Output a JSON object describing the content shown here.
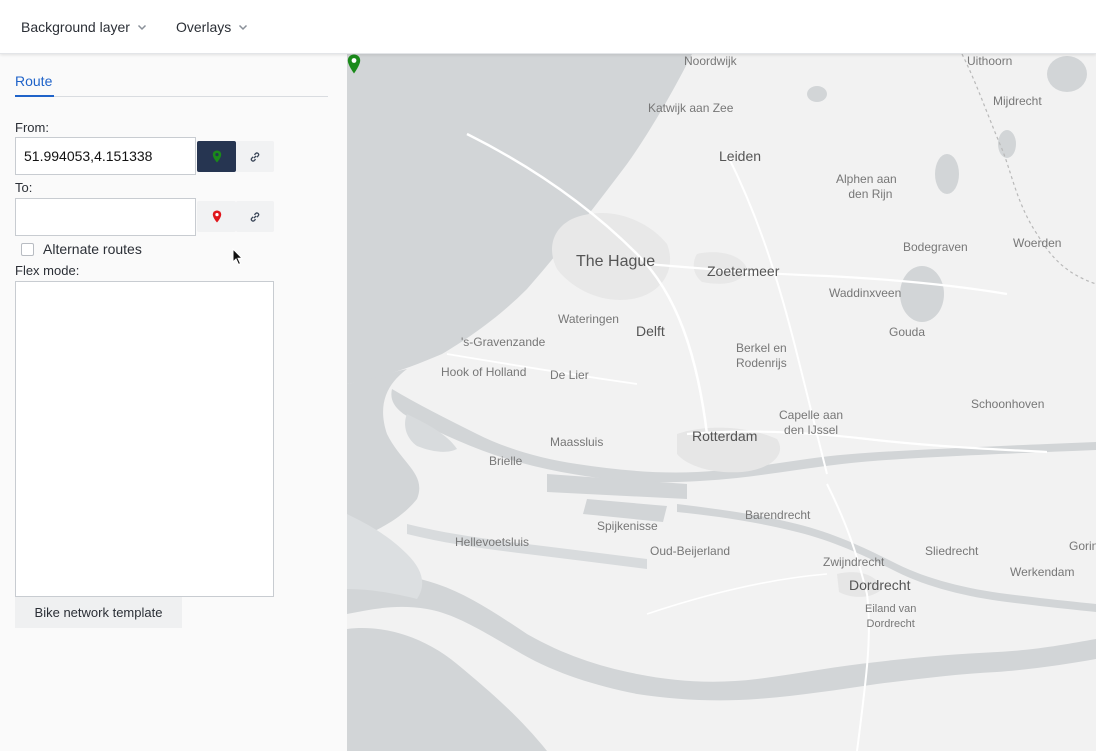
{
  "topbar": {
    "background_layer_label": "Background layer",
    "overlays_label": "Overlays"
  },
  "sidebar": {
    "tab_route": "Route",
    "from_label": "From:",
    "from_value": "51.994053,4.151338",
    "to_label": "To:",
    "to_value": "",
    "alternate_routes_label": "Alternate routes",
    "alternate_routes_checked": false,
    "flex_mode_label": "Flex mode:",
    "flex_mode_value": "",
    "bike_network_template_label": "Bike network template"
  },
  "map": {
    "places": {
      "noordwijk": "Noordwijk",
      "uithoorn": "Uithoorn",
      "mijdrecht": "Mijdrecht",
      "katwijk": "Katwijk aan Zee",
      "leiden": "Leiden",
      "alphen_1": "Alphen aan",
      "alphen_2": "den Rijn",
      "bodegraven": "Bodegraven",
      "woerden": "Woerden",
      "the_hague": "The Hague",
      "zoetermeer": "Zoetermeer",
      "waddinxveen": "Waddinxveen",
      "wateringen": "Wateringen",
      "delft": "Delft",
      "gouda": "Gouda",
      "gravenzande": "'s-Gravenzande",
      "berkel_1": "Berkel en",
      "berkel_2": "Rodenrijs",
      "hook_of_holland": "Hook of Holland",
      "de_lier": "De Lier",
      "schoonhoven": "Schoonhoven",
      "capelle_1": "Capelle aan",
      "capelle_2": "den IJssel",
      "rotterdam": "Rotterdam",
      "maassluis": "Maassluis",
      "brielle": "Brielle",
      "barendrecht": "Barendrecht",
      "spijkenisse": "Spijkenisse",
      "hellevoetsluis": "Hellevoetsluis",
      "oud_beijerland": "Oud-Beijerland",
      "sliedrecht": "Sliedrecht",
      "gorinchem": "Gorin",
      "zwijndrecht": "Zwijndrecht",
      "werkendam": "Werkendam",
      "dordrecht": "Dordrecht",
      "eiland_1": "Eiland van",
      "eiland_2": "Dordrecht"
    }
  },
  "colors": {
    "accent": "#1f63c9",
    "active_pin_button": "#263551",
    "start_marker": "#1a8a1a",
    "end_marker": "#e0161b",
    "water": "#d2d5d7",
    "land": "#f2f2f2"
  },
  "icons": {
    "chevron": "chevron-down-icon",
    "start_pin": "map-pin-green-icon",
    "end_pin": "map-pin-red-icon",
    "link": "link-icon"
  }
}
